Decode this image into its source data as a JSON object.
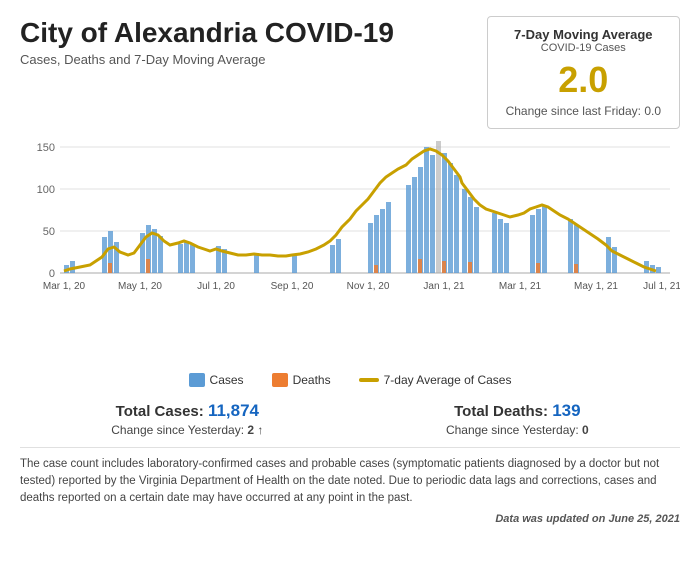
{
  "header": {
    "main_title": "City of Alexandria COVID-19",
    "subtitle": "Cases, Deaths and 7-Day Moving Average"
  },
  "stat_box": {
    "title": "7-Day Moving Average",
    "subtitle": "COVID-19 Cases",
    "value": "2.0",
    "change_label": "Change since last Friday:",
    "change_value": "0.0"
  },
  "legend": {
    "cases_label": "Cases",
    "deaths_label": "Deaths",
    "avg_label": "7-day Average of Cases"
  },
  "totals": {
    "cases_label": "Total Cases:",
    "cases_value": "11,874",
    "cases_change_label": "Change since Yesterday:",
    "cases_change_value": "2",
    "cases_arrow": "↑",
    "deaths_label": "Total Deaths:",
    "deaths_value": "139",
    "deaths_change_label": "Change since Yesterday:",
    "deaths_change_value": "0"
  },
  "footer": {
    "note": "The case count includes laboratory-confirmed cases and probable cases (symptomatic patients diagnosed by a doctor but not tested) reported by the Virginia Department of Health on the date noted. Due to periodic data lags and corrections, cases and deaths reported on a certain date may have occurred at any point in the past.",
    "updated_prefix": "Data was updated on",
    "updated_date": "June 25, 2021"
  },
  "chart": {
    "y_labels": [
      "150",
      "100",
      "50",
      "0"
    ],
    "x_labels": [
      "Mar 1, 20",
      "May 1, 20",
      "Jul 1, 20",
      "Sep 1, 20",
      "Nov 1, 20",
      "Jan 1, 21",
      "Mar 1, 21",
      "May 1, 21",
      "Jul 1, 21"
    ]
  }
}
